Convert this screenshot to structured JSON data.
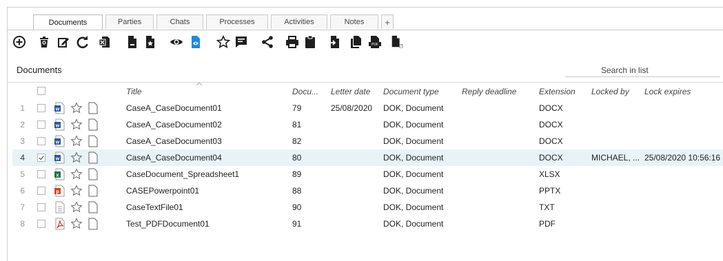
{
  "tabs": [
    {
      "label": "Documents",
      "active": true
    },
    {
      "label": "Parties"
    },
    {
      "label": "Chats"
    },
    {
      "label": "Processes"
    },
    {
      "label": "Activities"
    },
    {
      "label": "Notes"
    }
  ],
  "tab_add_label": "+",
  "toolbar": {
    "icons": [
      "add-icon",
      "delete-icon",
      "edit-icon",
      "refresh-icon",
      "excel-export-icon",
      "document-icon",
      "document-star-icon",
      "view-icon",
      "preview-icon",
      "favorite-star-icon",
      "comment-icon",
      "share-icon",
      "print-icon",
      "clipboard-icon",
      "document-arrow-icon",
      "copy-icon",
      "pdf-icon",
      "document-undo-icon"
    ]
  },
  "section": {
    "title": "Documents"
  },
  "search": {
    "placeholder": "Search in list"
  },
  "columns": {
    "title": "Title",
    "docno": "Docu...",
    "letter_date": "Letter date",
    "doc_type": "Document type",
    "reply_deadline": "Reply deadline",
    "extension": "Extension",
    "locked_by": "Locked by",
    "lock_expires": "Lock expires"
  },
  "rows": [
    {
      "num": "1",
      "title": "CaseA_CaseDocument01",
      "docno": "79",
      "letter_date": "25/08/2020",
      "doc_type": "DOK, Document",
      "reply_deadline": "",
      "extension": "DOCX",
      "locked_by": "",
      "lock_expires": "",
      "filetype": "word",
      "checked": false
    },
    {
      "num": "2",
      "title": "CaseA_CaseDocument02",
      "docno": "81",
      "letter_date": "",
      "doc_type": "DOK, Document",
      "reply_deadline": "",
      "extension": "DOCX",
      "locked_by": "",
      "lock_expires": "",
      "filetype": "word",
      "checked": false
    },
    {
      "num": "3",
      "title": "CaseA_CaseDocument03",
      "docno": "82",
      "letter_date": "",
      "doc_type": "DOK, Document",
      "reply_deadline": "",
      "extension": "DOCX",
      "locked_by": "",
      "lock_expires": "",
      "filetype": "word",
      "checked": false
    },
    {
      "num": "4",
      "title": "CaseA_CaseDocument04",
      "docno": "80",
      "letter_date": "",
      "doc_type": "DOK, Document",
      "reply_deadline": "",
      "extension": "DOCX",
      "locked_by": "MICHAEL, ...",
      "lock_expires": "25/08/2020 10:56:16",
      "filetype": "word",
      "checked": true,
      "selected": true
    },
    {
      "num": "5",
      "title": "CaseDocument_Spreadsheet1",
      "docno": "89",
      "letter_date": "",
      "doc_type": "DOK, Document",
      "reply_deadline": "",
      "extension": "XLSX",
      "locked_by": "",
      "lock_expires": "",
      "filetype": "excel",
      "checked": false
    },
    {
      "num": "6",
      "title": "CASEPowerpoint01",
      "docno": "88",
      "letter_date": "",
      "doc_type": "DOK, Document",
      "reply_deadline": "",
      "extension": "PPTX",
      "locked_by": "",
      "lock_expires": "",
      "filetype": "powerpoint",
      "checked": false
    },
    {
      "num": "7",
      "title": "CaseTextFile01",
      "docno": "90",
      "letter_date": "",
      "doc_type": "DOK, Document",
      "reply_deadline": "",
      "extension": "TXT",
      "locked_by": "",
      "lock_expires": "",
      "filetype": "text",
      "checked": false
    },
    {
      "num": "8",
      "title": "Test_PDFDocument01",
      "docno": "91",
      "letter_date": "",
      "doc_type": "DOK, Document",
      "reply_deadline": "",
      "extension": "PDF",
      "locked_by": "",
      "lock_expires": "",
      "filetype": "pdf",
      "checked": false
    }
  ],
  "colors": {
    "selected_row": "#e8f3f8",
    "word": "#2b579a",
    "excel": "#217346",
    "powerpoint": "#d24726",
    "pdf": "#d9322f",
    "toolbar_accent": "#1e88e5"
  }
}
